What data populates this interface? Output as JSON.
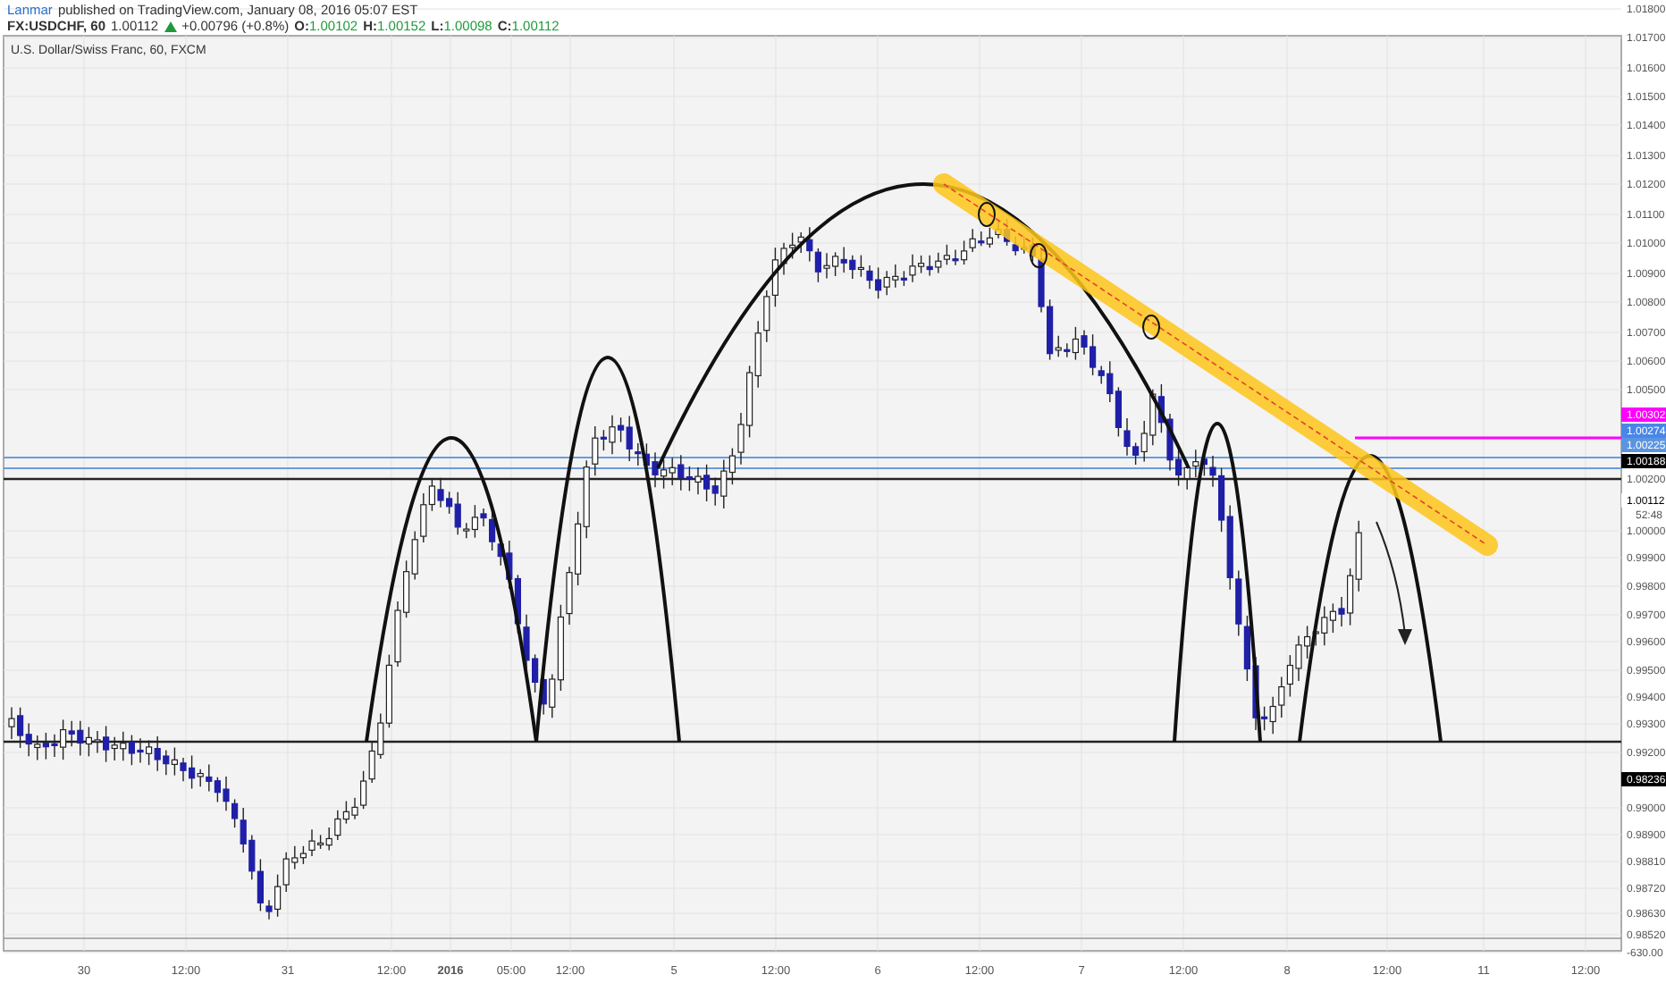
{
  "header": {
    "author": "Lanmar",
    "published": "published on TradingView.com, January 08, 2016 05:07 EST"
  },
  "quote": {
    "symbol": "FX:USDCHF, 60",
    "last": "1.00112",
    "rising": true,
    "change": "+0.00796 (+0.8%)",
    "ohlc": [
      {
        "key": "O:",
        "value": "1.00102"
      },
      {
        "key": "H:",
        "value": "1.00152"
      },
      {
        "key": "L:",
        "value": "1.00098"
      },
      {
        "key": "C:",
        "value": "1.00112"
      }
    ]
  },
  "chart": {
    "legend": "U.S. Dollar/Swiss Franc, 60, FXCM"
  },
  "price_axis": {
    "labels": [
      "1.01800",
      "1.01700",
      "1.01600",
      "1.01500",
      "1.01400",
      "1.01300",
      "1.01200",
      "1.01100",
      "1.01000",
      "1.00900",
      "1.00800",
      "1.00700",
      "1.00600",
      "1.00500",
      "1.00200",
      "1.00000",
      "0.99900",
      "0.99800",
      "0.99700",
      "0.99600",
      "0.99500",
      "0.99400",
      "0.99300",
      "0.99200",
      "0.99000",
      "0.98900",
      "0.98810",
      "0.98720",
      "0.98630",
      "0.98520",
      "-630.00"
    ],
    "badges": [
      {
        "text": "1.00302",
        "color": "#ff00ff"
      },
      {
        "text": "1.00274",
        "color": "#4a86e8"
      },
      {
        "text": "1.00225",
        "color": "#5b95e0"
      },
      {
        "text": "1.00188",
        "color": "#000000"
      },
      {
        "text": "1.00112",
        "color": "#ffffff"
      },
      {
        "text": "0.98236",
        "color": "#000000"
      }
    ],
    "countdown": "52:48"
  },
  "time_axis": {
    "labels": [
      {
        "text": "30",
        "bold": false
      },
      {
        "text": "12:00",
        "bold": false
      },
      {
        "text": "31",
        "bold": false
      },
      {
        "text": "12:00",
        "bold": false
      },
      {
        "text": "2016",
        "bold": true
      },
      {
        "text": "05:00",
        "bold": false
      },
      {
        "text": "12:00",
        "bold": false
      },
      {
        "text": "5",
        "bold": false
      },
      {
        "text": "12:00",
        "bold": false
      },
      {
        "text": "6",
        "bold": false
      },
      {
        "text": "12:00",
        "bold": false
      },
      {
        "text": "7",
        "bold": false
      },
      {
        "text": "12:00",
        "bold": false
      },
      {
        "text": "8",
        "bold": false
      },
      {
        "text": "12:00",
        "bold": false
      },
      {
        "text": "11",
        "bold": false
      },
      {
        "text": "12:00",
        "bold": false
      }
    ]
  }
}
